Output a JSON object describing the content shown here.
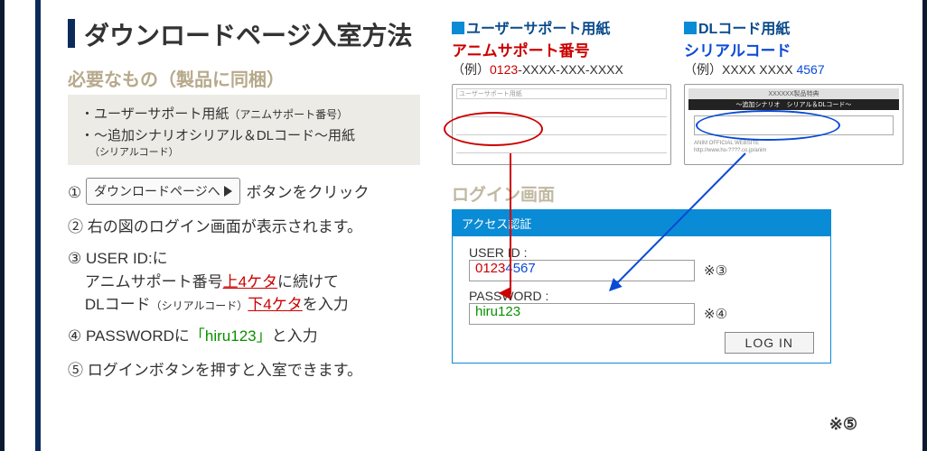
{
  "title": "ダウンロードページ入室方法",
  "need_label": "必要なもの（製品に同梱）",
  "need_items": {
    "a": "・ユーザーサポート用紙",
    "a_sub": "（アニムサポート番号）",
    "b": "・〜追加シナリオシリアル＆DLコード〜用紙",
    "b_sub": "（シリアルコード）"
  },
  "steps": {
    "s1_btn": "ダウンロードページへ",
    "s1_tail": " ボタンをクリック",
    "s2": "右の図のログイン画面が表示されます。",
    "s3a": "USER ID:に",
    "s3b_pre": "アニムサポート番号",
    "s3b_red": "上4ケタ",
    "s3b_mid": "に続けて",
    "s3c_pre": "DLコード",
    "s3c_sub": "（シリアルコード）",
    "s3c_red": "下4ケタ",
    "s3c_tail": "を入力",
    "s4_pre": "PASSWORDに",
    "s4_lq": "「",
    "s4_val": "hiru123",
    "s4_rq": "」",
    "s4_tail": "と入力",
    "s5": "ログインボタンを押すと入室できます。"
  },
  "nums": [
    "①",
    "②",
    "③",
    "④",
    "⑤"
  ],
  "cards": {
    "user_support": {
      "title": "ユーザーサポート用紙",
      "subtitle": "アニムサポート番号",
      "eg_label": "（例）",
      "eg_red": "0123",
      "eg_rest": "-XXXX-XXX-XXXX",
      "inner": "ユーザーサポート用紙"
    },
    "dlcode": {
      "title": "DLコード用紙",
      "subtitle": "シリアルコード",
      "eg_label": "（例）",
      "eg_pre": "XXXX XXXX ",
      "eg_blue": "4567",
      "band1": "XXXXXX製品特典",
      "band2": "〜追加シナリオ　シリアル＆DLコード〜",
      "foot1": "ANIM OFFICIAL WEBSITE",
      "foot2": "http://www.ho-????.co.jp/anim"
    }
  },
  "login": {
    "section_title": "ログイン画面",
    "header": "アクセス認証",
    "uid_label": "USER ID :",
    "uid_red": "0123",
    "uid_blue": "4567",
    "ref3": "※③",
    "pwd_label": "PASSWORD :",
    "pwd_val": "hiru123",
    "ref4": "※④",
    "btn": "LOG IN",
    "ref5": "※⑤"
  }
}
